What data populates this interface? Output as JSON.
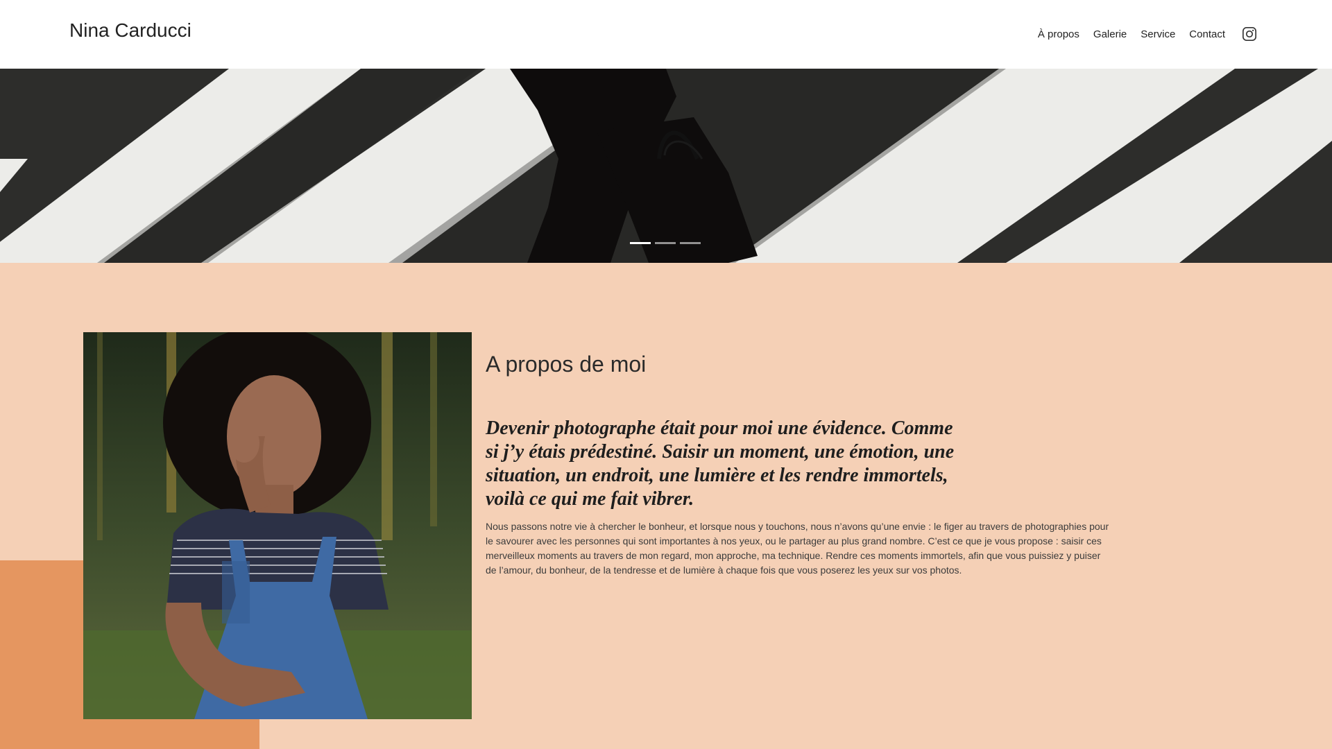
{
  "header": {
    "brand": "Nina Carducci",
    "nav": [
      {
        "label": "À propos"
      },
      {
        "label": "Galerie"
      },
      {
        "label": "Service"
      },
      {
        "label": "Contact"
      }
    ],
    "instagram_icon": "instagram-icon"
  },
  "hero": {
    "slides_count": 3,
    "active_slide": 1
  },
  "about": {
    "title": "A propos de moi",
    "quote": "Devenir photographe était pour moi une évidence. Comme si j’y étais prédestiné. Saisir un moment, une émotion, une situation, un endroit, une lumière et les rendre immortels, voilà ce qui me fait vibrer.",
    "body": "Nous passons notre vie à chercher le bonheur, et lorsque nous y touchons, nous n’avons qu’une envie : le figer au travers de photographies pour le savourer avec les personnes qui sont importantes à nos yeux, ou le partager au plus grand nombre. C’est ce que je vous propose : saisir ces merveilleux moments au travers de mon regard, mon approche, ma technique. Rendre ces moments immortels, afin que vous puissiez y puiser de l’amour, du bonheur, de la tendresse et de lumière à chaque fois que vous poserez les yeux sur vos photos."
  },
  "colors": {
    "section_bg": "#f5d0b6",
    "accent": "#e59660",
    "text": "#222222"
  }
}
